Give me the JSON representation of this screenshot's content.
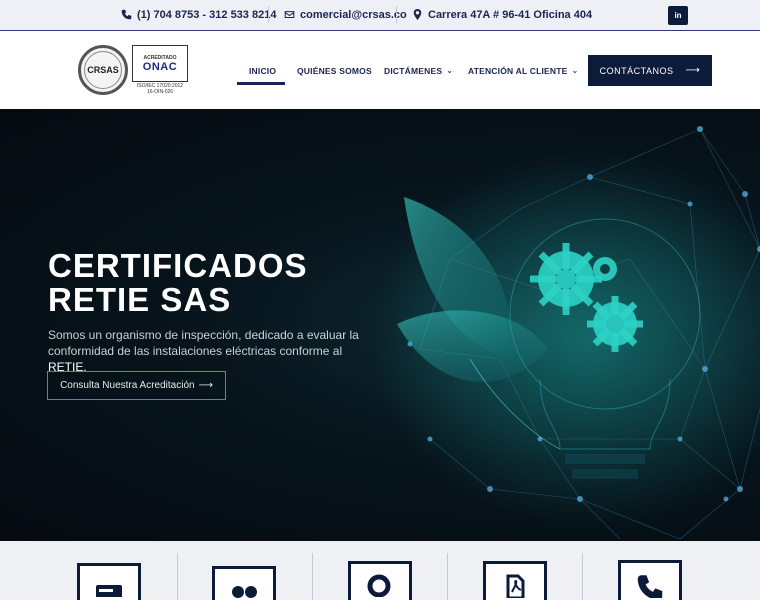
{
  "topbar": {
    "phone": "(1) 704 8753 - 312 533 8214",
    "email": "comercial@crsas.co",
    "address": "Carrera 47A # 96-41 Oficina 404",
    "social": "in"
  },
  "logo": {
    "circle_text": "CRSAS",
    "onac_small": "ACREDITADO",
    "onac_big": "ONAC",
    "onac_line1": "ISO/IEC 17020:2012",
    "onac_line2": "16-OIN-026"
  },
  "nav": {
    "items": [
      {
        "label": "INICIO"
      },
      {
        "label": "QUIÉNES SOMOS"
      },
      {
        "label": "DICTÁMENES"
      },
      {
        "label": "ATENCIÓN AL CLIENTE"
      }
    ],
    "cta_label": "CONTÁCTANOS"
  },
  "hero": {
    "title_line1": "CERTIFICADOS",
    "title_line2": "RETIE SAS",
    "subtitle": "Somos un organismo de inspección, dedicado a evaluar la conformidad de las instalaciones eléctricas conforme al",
    "subtitle_em": "RETIE.",
    "button_label": "Consulta Nuestra Acreditación"
  },
  "colors": {
    "brand": "#0d1b3a",
    "accent": "#1ee0d0",
    "topbar_bg": "#eef0f5"
  },
  "services": {
    "icons": [
      "card-icon",
      "dots-icon",
      "search-icon",
      "pdf-icon",
      "phone-icon"
    ]
  }
}
